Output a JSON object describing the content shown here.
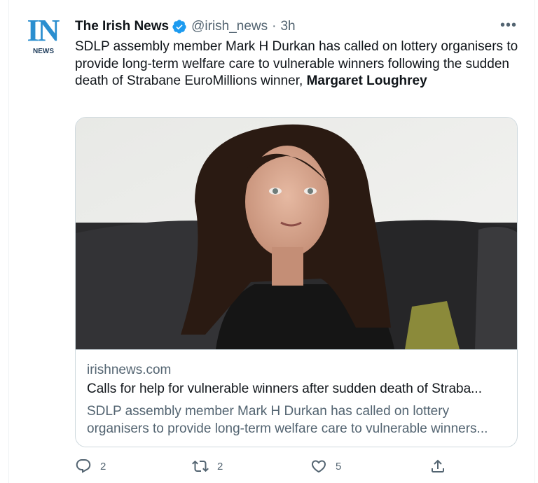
{
  "account": {
    "logo_text": "IN",
    "logo_sub": "NEWS",
    "name": "The Irish News",
    "handle": "@irish_news",
    "separator": "·",
    "time": "3h",
    "verified_icon": "verified-badge-icon",
    "brand_color": "#2a8ecf"
  },
  "more_label": "•••",
  "tweet": {
    "text_plain": "SDLP assembly member Mark H Durkan has called on lottery organisers to provide long-term welfare care to vulnerable winners following the sudden death of Strabane EuroMillions winner, ",
    "text_bold": "Margaret Loughrey"
  },
  "card": {
    "image_icon": "article-photo",
    "domain": "irishnews.com",
    "title": "Calls for help for vulnerable winners after sudden death of Straba...",
    "description_line1": "SDLP assembly member Mark H Durkan has called on lottery",
    "description_line2": "organisers to provide long-term welfare care to vulnerable winners..."
  },
  "actions": {
    "reply_icon": "reply-icon",
    "reply_count": "2",
    "retweet_icon": "retweet-icon",
    "retweet_count": "2",
    "like_icon": "heart-icon",
    "like_count": "5",
    "share_icon": "share-icon"
  },
  "colors": {
    "text": "#0f1419",
    "secondary": "#536471",
    "border": "#cfd9de",
    "verified": "#1d9bf0"
  }
}
